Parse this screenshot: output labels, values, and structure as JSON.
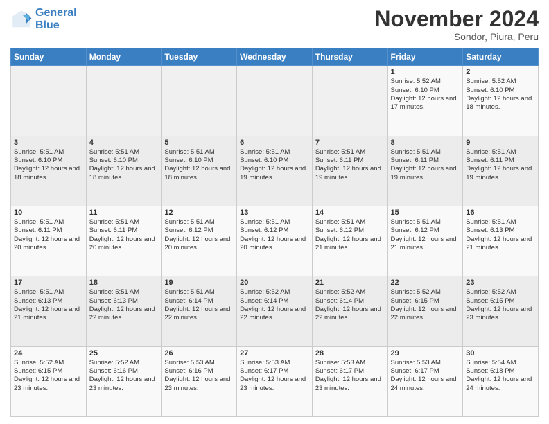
{
  "header": {
    "logo_line1": "General",
    "logo_line2": "Blue",
    "main_title": "November 2024",
    "subtitle": "Sondor, Piura, Peru"
  },
  "days_of_week": [
    "Sunday",
    "Monday",
    "Tuesday",
    "Wednesday",
    "Thursday",
    "Friday",
    "Saturday"
  ],
  "weeks": [
    [
      {
        "day": "",
        "info": ""
      },
      {
        "day": "",
        "info": ""
      },
      {
        "day": "",
        "info": ""
      },
      {
        "day": "",
        "info": ""
      },
      {
        "day": "",
        "info": ""
      },
      {
        "day": "1",
        "info": "Sunrise: 5:52 AM\nSunset: 6:10 PM\nDaylight: 12 hours and 17 minutes."
      },
      {
        "day": "2",
        "info": "Sunrise: 5:52 AM\nSunset: 6:10 PM\nDaylight: 12 hours and 18 minutes."
      }
    ],
    [
      {
        "day": "3",
        "info": "Sunrise: 5:51 AM\nSunset: 6:10 PM\nDaylight: 12 hours and 18 minutes."
      },
      {
        "day": "4",
        "info": "Sunrise: 5:51 AM\nSunset: 6:10 PM\nDaylight: 12 hours and 18 minutes."
      },
      {
        "day": "5",
        "info": "Sunrise: 5:51 AM\nSunset: 6:10 PM\nDaylight: 12 hours and 18 minutes."
      },
      {
        "day": "6",
        "info": "Sunrise: 5:51 AM\nSunset: 6:10 PM\nDaylight: 12 hours and 19 minutes."
      },
      {
        "day": "7",
        "info": "Sunrise: 5:51 AM\nSunset: 6:11 PM\nDaylight: 12 hours and 19 minutes."
      },
      {
        "day": "8",
        "info": "Sunrise: 5:51 AM\nSunset: 6:11 PM\nDaylight: 12 hours and 19 minutes."
      },
      {
        "day": "9",
        "info": "Sunrise: 5:51 AM\nSunset: 6:11 PM\nDaylight: 12 hours and 19 minutes."
      }
    ],
    [
      {
        "day": "10",
        "info": "Sunrise: 5:51 AM\nSunset: 6:11 PM\nDaylight: 12 hours and 20 minutes."
      },
      {
        "day": "11",
        "info": "Sunrise: 5:51 AM\nSunset: 6:11 PM\nDaylight: 12 hours and 20 minutes."
      },
      {
        "day": "12",
        "info": "Sunrise: 5:51 AM\nSunset: 6:12 PM\nDaylight: 12 hours and 20 minutes."
      },
      {
        "day": "13",
        "info": "Sunrise: 5:51 AM\nSunset: 6:12 PM\nDaylight: 12 hours and 20 minutes."
      },
      {
        "day": "14",
        "info": "Sunrise: 5:51 AM\nSunset: 6:12 PM\nDaylight: 12 hours and 21 minutes."
      },
      {
        "day": "15",
        "info": "Sunrise: 5:51 AM\nSunset: 6:12 PM\nDaylight: 12 hours and 21 minutes."
      },
      {
        "day": "16",
        "info": "Sunrise: 5:51 AM\nSunset: 6:13 PM\nDaylight: 12 hours and 21 minutes."
      }
    ],
    [
      {
        "day": "17",
        "info": "Sunrise: 5:51 AM\nSunset: 6:13 PM\nDaylight: 12 hours and 21 minutes."
      },
      {
        "day": "18",
        "info": "Sunrise: 5:51 AM\nSunset: 6:13 PM\nDaylight: 12 hours and 22 minutes."
      },
      {
        "day": "19",
        "info": "Sunrise: 5:51 AM\nSunset: 6:14 PM\nDaylight: 12 hours and 22 minutes."
      },
      {
        "day": "20",
        "info": "Sunrise: 5:52 AM\nSunset: 6:14 PM\nDaylight: 12 hours and 22 minutes."
      },
      {
        "day": "21",
        "info": "Sunrise: 5:52 AM\nSunset: 6:14 PM\nDaylight: 12 hours and 22 minutes."
      },
      {
        "day": "22",
        "info": "Sunrise: 5:52 AM\nSunset: 6:15 PM\nDaylight: 12 hours and 22 minutes."
      },
      {
        "day": "23",
        "info": "Sunrise: 5:52 AM\nSunset: 6:15 PM\nDaylight: 12 hours and 23 minutes."
      }
    ],
    [
      {
        "day": "24",
        "info": "Sunrise: 5:52 AM\nSunset: 6:15 PM\nDaylight: 12 hours and 23 minutes."
      },
      {
        "day": "25",
        "info": "Sunrise: 5:52 AM\nSunset: 6:16 PM\nDaylight: 12 hours and 23 minutes."
      },
      {
        "day": "26",
        "info": "Sunrise: 5:53 AM\nSunset: 6:16 PM\nDaylight: 12 hours and 23 minutes."
      },
      {
        "day": "27",
        "info": "Sunrise: 5:53 AM\nSunset: 6:17 PM\nDaylight: 12 hours and 23 minutes."
      },
      {
        "day": "28",
        "info": "Sunrise: 5:53 AM\nSunset: 6:17 PM\nDaylight: 12 hours and 23 minutes."
      },
      {
        "day": "29",
        "info": "Sunrise: 5:53 AM\nSunset: 6:17 PM\nDaylight: 12 hours and 24 minutes."
      },
      {
        "day": "30",
        "info": "Sunrise: 5:54 AM\nSunset: 6:18 PM\nDaylight: 12 hours and 24 minutes."
      }
    ]
  ]
}
